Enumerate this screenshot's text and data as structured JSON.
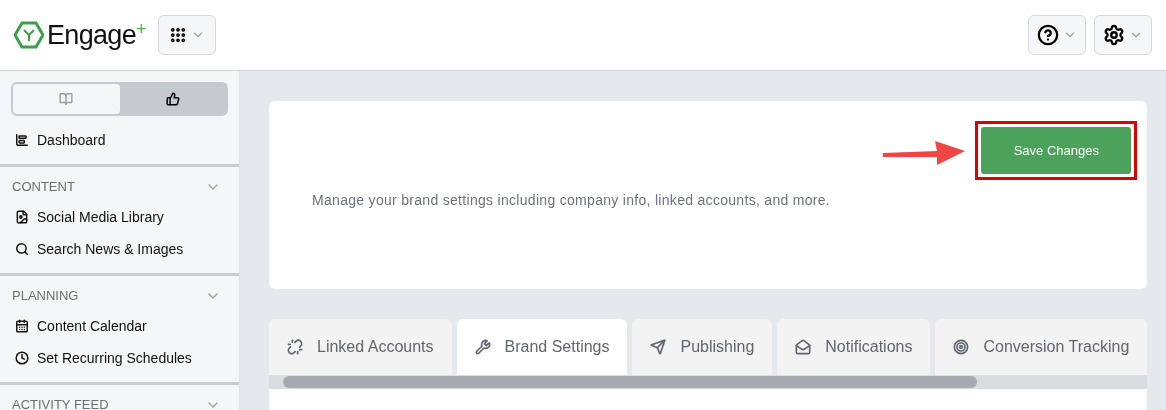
{
  "header": {
    "logo": "Engage",
    "logo_mark": "+"
  },
  "sidebar": {
    "toggle": [
      {
        "kind": "book",
        "selected": false
      },
      {
        "kind": "thumbs",
        "selected": true
      }
    ],
    "top_items": [
      {
        "kind": "chart",
        "label": "Dashboard"
      }
    ],
    "sections": [
      {
        "title": "CONTENT",
        "items": [
          {
            "kind": "file",
            "label": "Social Media Library"
          },
          {
            "kind": "search",
            "label": "Search News & Images"
          }
        ]
      },
      {
        "title": "PLANNING",
        "items": [
          {
            "kind": "calendar",
            "label": "Content Calendar"
          },
          {
            "kind": "clock",
            "label": "Set Recurring Schedules"
          }
        ]
      },
      {
        "title": "ACTIVITY FEED"
      }
    ]
  },
  "card": {
    "save_button": "Save Changes",
    "description": "Manage your brand settings including company info, linked accounts, and more."
  },
  "tabs": [
    {
      "kind": "link",
      "label": "Linked Accounts",
      "selected": false
    },
    {
      "kind": "wrench",
      "label": "Brand Settings",
      "selected": true
    },
    {
      "kind": "send",
      "label": "Publishing",
      "selected": false
    },
    {
      "kind": "mail",
      "label": "Notifications",
      "selected": false
    },
    {
      "kind": "target",
      "label": "Conversion Tracking",
      "selected": false
    }
  ]
}
